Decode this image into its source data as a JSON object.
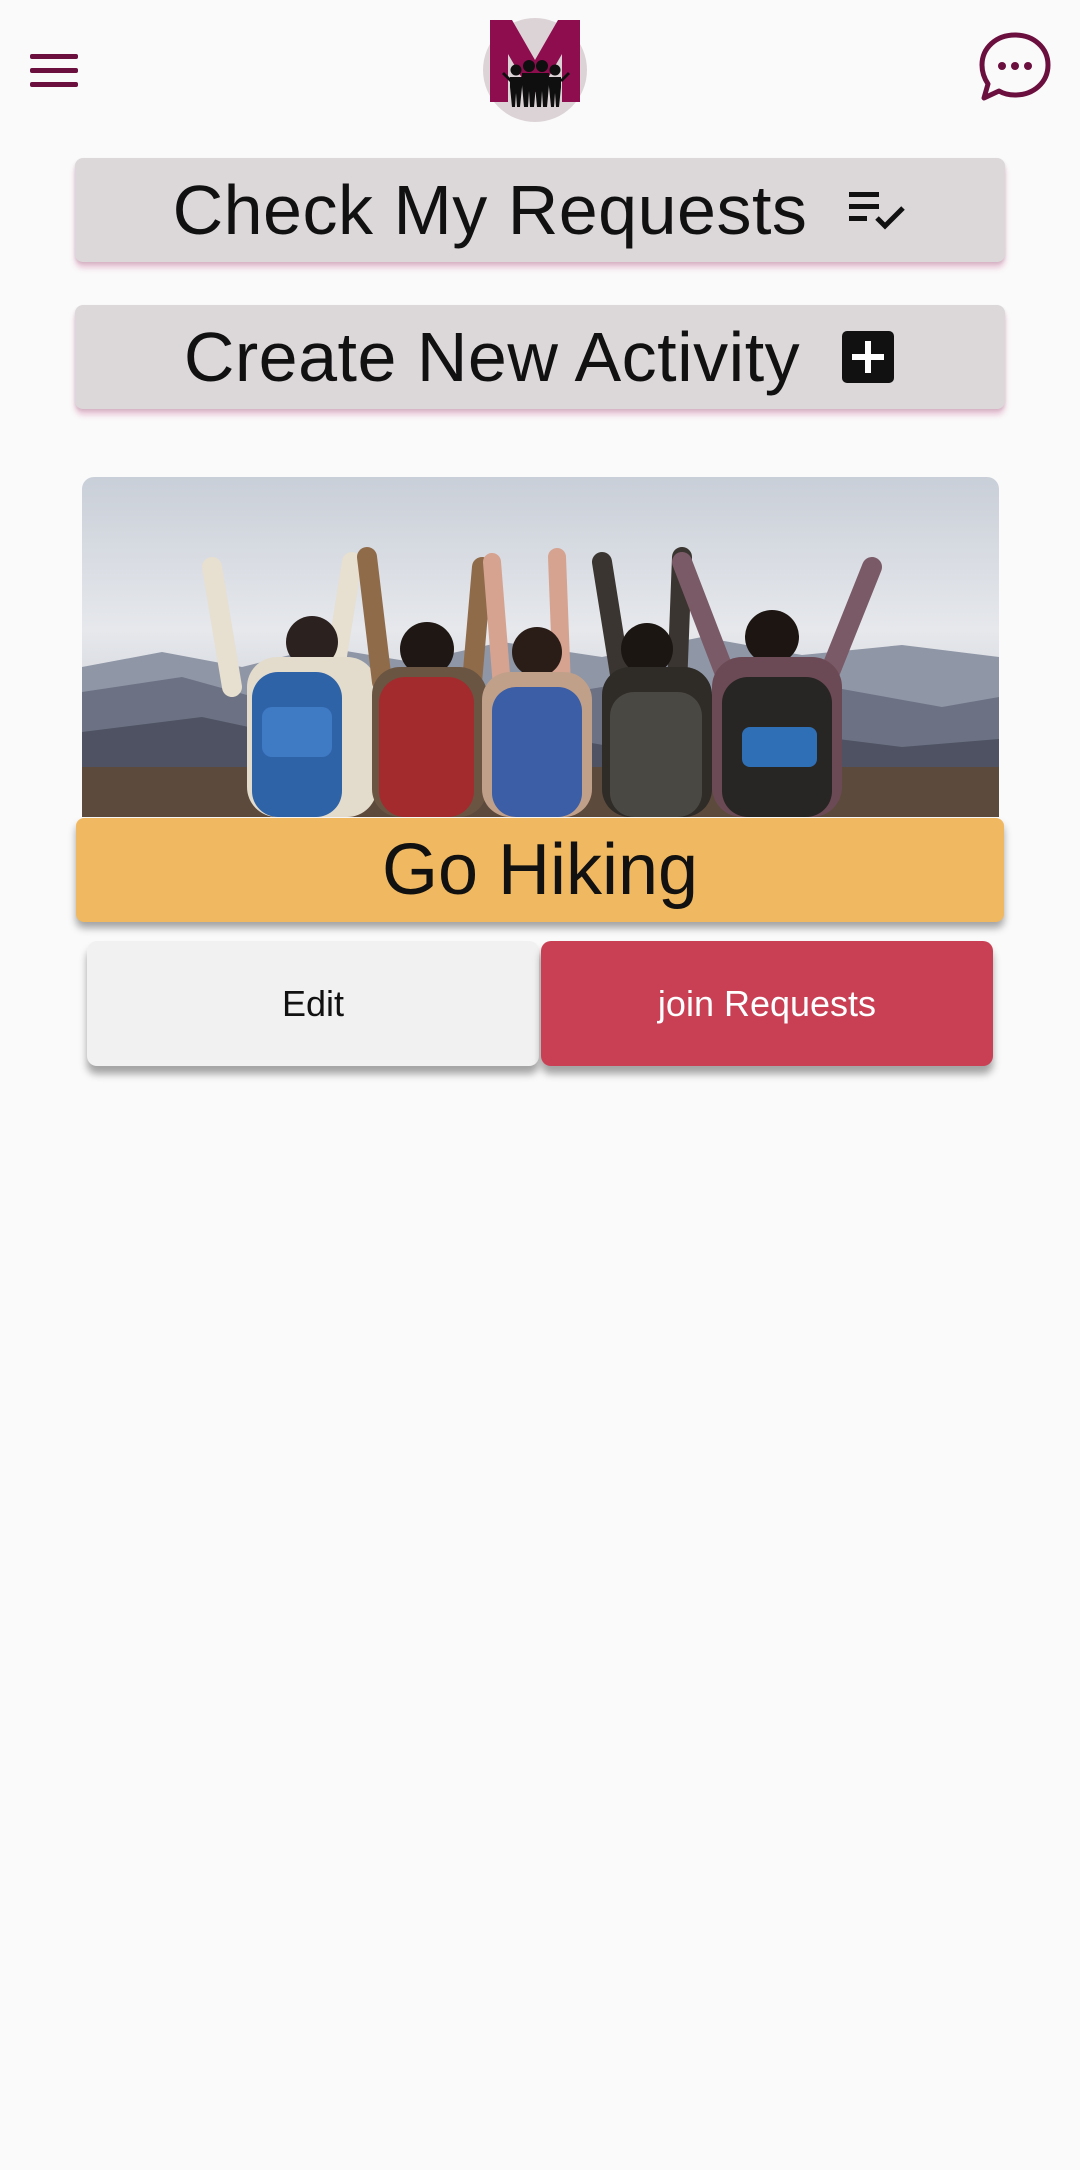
{
  "header": {
    "menu_icon": "hamburger-menu-icon",
    "logo_icon": "group-logo-icon",
    "chat_icon": "chat-bubble-icon",
    "accent_color": "#6b0f3f"
  },
  "actions": {
    "check_requests_label": "Check My Requests",
    "check_requests_icon": "playlist-check-icon",
    "create_activity_label": "Create New Activity",
    "create_activity_icon": "add-box-icon"
  },
  "activity_card": {
    "image": "hikers-raising-arms-photo",
    "title": "Go Hiking",
    "title_bar_color": "#f0b860",
    "edit_label": "Edit",
    "join_label": "join Requests",
    "join_color": "#c94055"
  }
}
